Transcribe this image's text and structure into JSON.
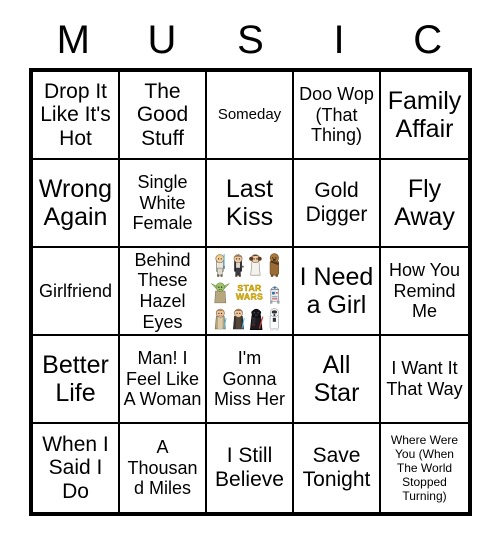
{
  "card": {
    "title_letters": [
      "M",
      "U",
      "S",
      "I",
      "C"
    ],
    "grid_size": "5x5",
    "background_color": "#ffffff",
    "border_color": "#000000"
  },
  "columns": [
    {
      "letter": "M"
    },
    {
      "letter": "U"
    },
    {
      "letter": "S"
    },
    {
      "letter": "I"
    },
    {
      "letter": "C"
    }
  ],
  "cells": [
    {
      "text": "Drop It Like It's Hot",
      "size": "lg",
      "type": "text"
    },
    {
      "text": "The Good Stuff",
      "size": "lg",
      "type": "text"
    },
    {
      "text": "Someday",
      "size": "sm",
      "type": "text"
    },
    {
      "text": "Doo Wop (That Thing)",
      "size": "md",
      "type": "text"
    },
    {
      "text": "Family Affair",
      "size": "xl",
      "type": "text"
    },
    {
      "text": "Wrong Again",
      "size": "xl",
      "type": "text"
    },
    {
      "text": "Single White Female",
      "size": "md",
      "type": "text"
    },
    {
      "text": "Last Kiss",
      "size": "xl",
      "type": "text"
    },
    {
      "text": "Gold Digger",
      "size": "lg",
      "type": "text"
    },
    {
      "text": "Fly Away",
      "size": "xl",
      "type": "text"
    },
    {
      "text": "Girlfriend",
      "size": "md",
      "type": "text"
    },
    {
      "text": "Behind These Hazel Eyes",
      "size": "md",
      "type": "text"
    },
    {
      "text": "",
      "size": "md",
      "type": "image",
      "image_name": "star-wars-characters-free-space"
    },
    {
      "text": "I Need a Girl",
      "size": "xl",
      "type": "text"
    },
    {
      "text": "How You Remind Me",
      "size": "md",
      "type": "text"
    },
    {
      "text": "Better Life",
      "size": "xl",
      "type": "text"
    },
    {
      "text": "Man! I Feel Like A Woman",
      "size": "md",
      "type": "text"
    },
    {
      "text": "I'm Gonna Miss Her",
      "size": "md",
      "type": "text"
    },
    {
      "text": "All Star",
      "size": "xl",
      "type": "text"
    },
    {
      "text": "I Want It That Way",
      "size": "md",
      "type": "text"
    },
    {
      "text": "When I Said I Do",
      "size": "lg",
      "type": "text"
    },
    {
      "text": "A Thousand Miles",
      "size": "md",
      "type": "text"
    },
    {
      "text": "I Still Believe",
      "size": "lg",
      "type": "text"
    },
    {
      "text": "Save Tonight",
      "size": "lg",
      "type": "text"
    },
    {
      "text": "Where Were You (When The World Stopped Turning)",
      "size": "xs",
      "type": "text"
    }
  ],
  "free_space_art": {
    "label": "Star Wars chibi character sticker sheet",
    "logo_text": "STAR WARS",
    "logo_color": "#f2c200",
    "row1": [
      "Luke Skywalker",
      "Han Solo",
      "Princess Leia",
      "Chewbacca"
    ],
    "row2": [
      "Yoda",
      "Star Wars logo",
      "R2-D2"
    ],
    "row3": [
      "Obi-Wan Kenobi",
      "Anakin Skywalker",
      "Darth Vader",
      "Stormtrooper"
    ]
  }
}
